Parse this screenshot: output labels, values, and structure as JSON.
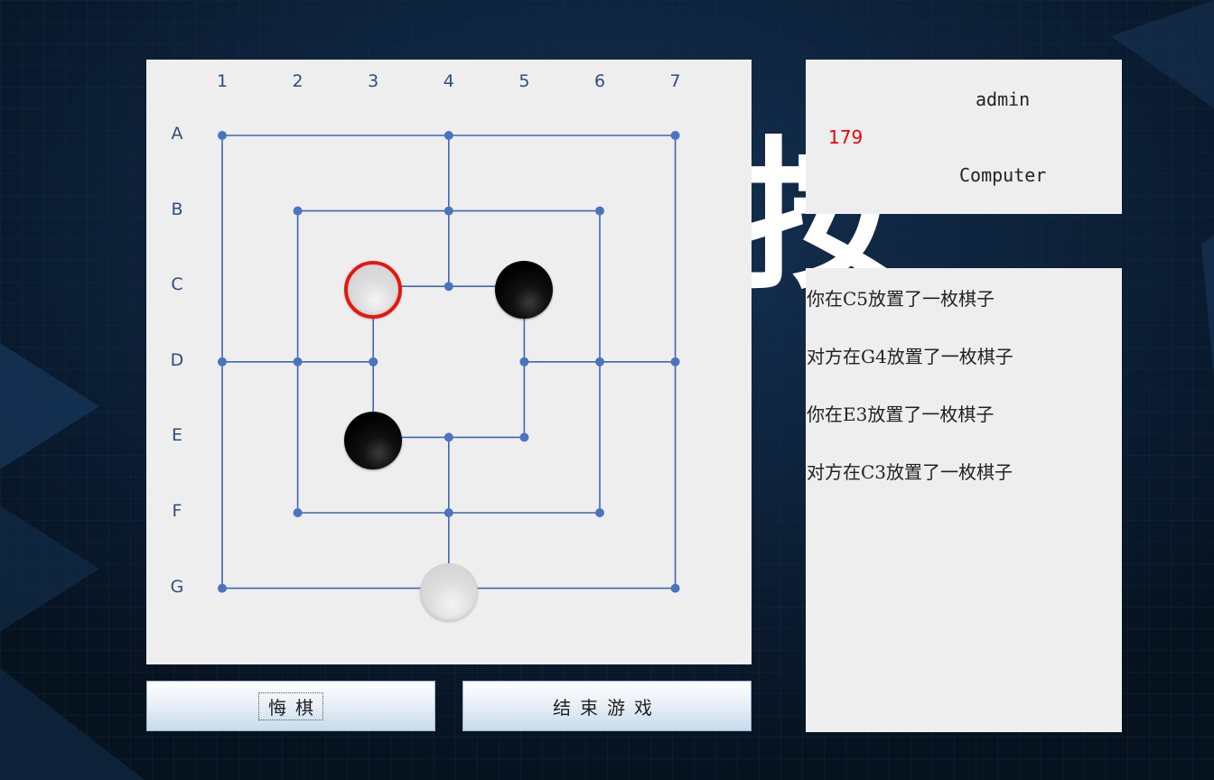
{
  "board": {
    "col_labels": [
      "1",
      "2",
      "3",
      "4",
      "5",
      "6",
      "7"
    ],
    "row_labels": [
      "A",
      "B",
      "C",
      "D",
      "E",
      "F",
      "G"
    ],
    "line_color": "#3e67b1",
    "stones": [
      {
        "pos": "C3",
        "color": "white",
        "selected": true
      },
      {
        "pos": "C5",
        "color": "black",
        "selected": false
      },
      {
        "pos": "E3",
        "color": "black",
        "selected": false
      },
      {
        "pos": "G4",
        "color": "white",
        "selected": false
      }
    ]
  },
  "info": {
    "player1": "admin",
    "score": "179",
    "player2": "Computer",
    "score_color": "#f00000"
  },
  "log": [
    "你在C5放置了一枚棋子",
    "对方在G4放置了一枚棋子",
    "你在E3放置了一枚棋子",
    "对方在C3放置了一枚棋子"
  ],
  "buttons": {
    "undo": "悔棋",
    "end": "结束游戏"
  },
  "background": {
    "color": "#0c1c33",
    "glyph": "按"
  }
}
